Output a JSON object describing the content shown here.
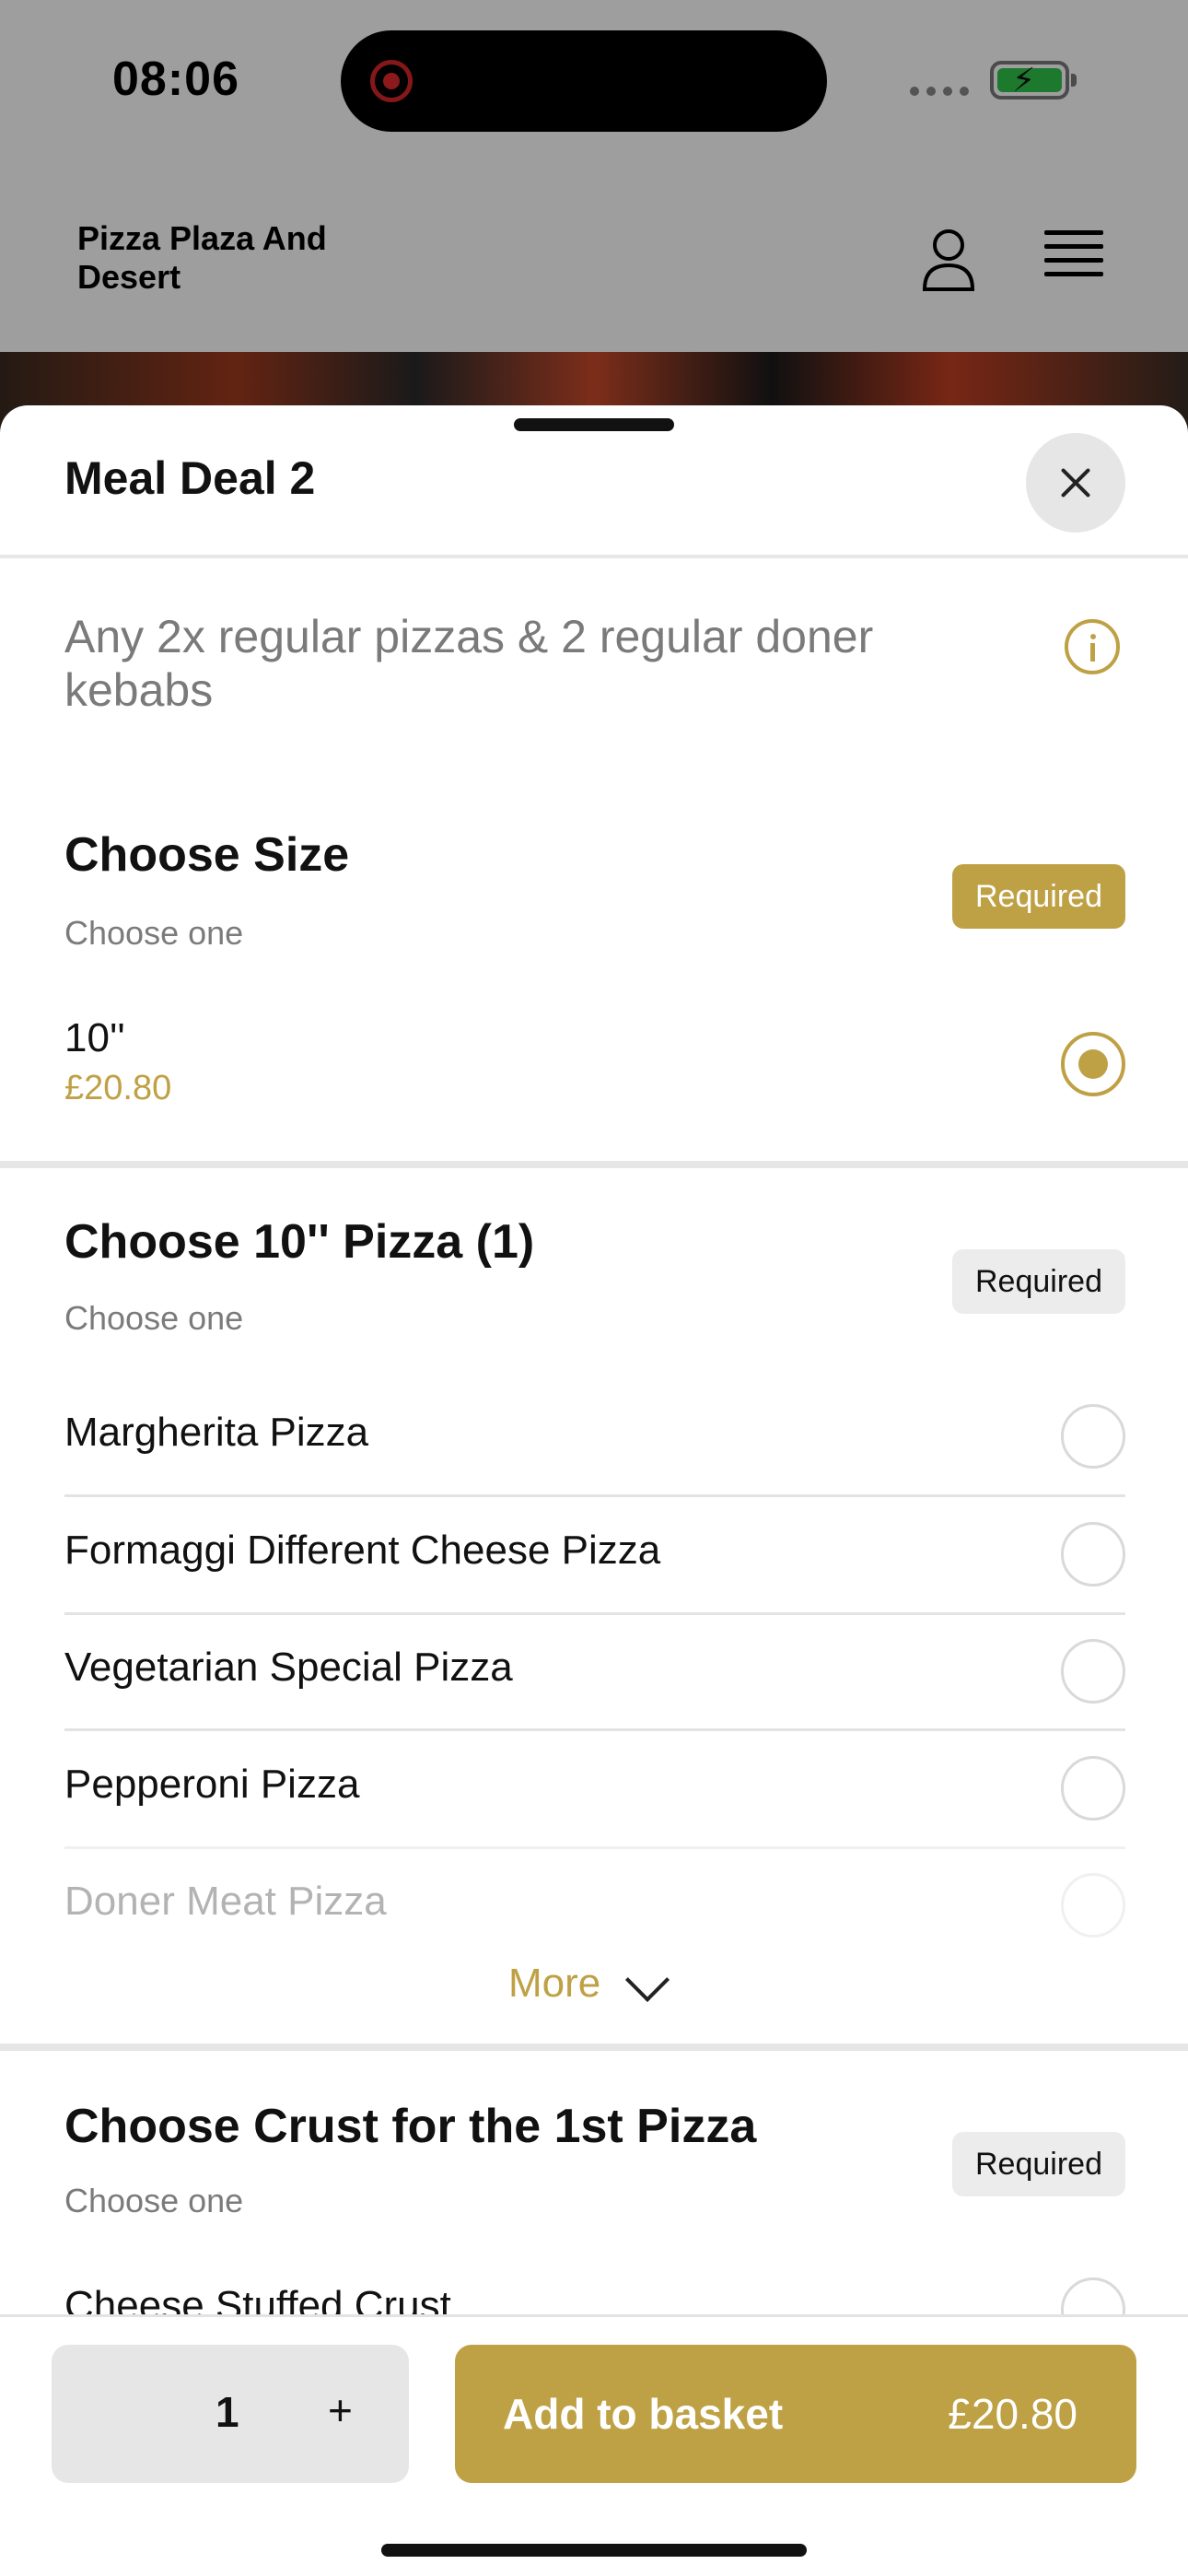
{
  "status_bar": {
    "time": "08:06"
  },
  "store": {
    "name": "Pizza Plaza And Desert"
  },
  "sheet": {
    "title": "Meal Deal 2",
    "description": "Any 2x regular pizzas & 2 regular doner kebabs"
  },
  "size_section": {
    "title": "Choose Size",
    "subtitle": "Choose one",
    "badge": "Required",
    "option": {
      "label": "10''",
      "price": "£20.80",
      "selected": true
    }
  },
  "pizza_section": {
    "title": "Choose 10'' Pizza (1)",
    "subtitle": "Choose one",
    "badge": "Required",
    "options": [
      {
        "label": "Margherita Pizza"
      },
      {
        "label": "Formaggi Different Cheese Pizza"
      },
      {
        "label": "Vegetarian Special Pizza"
      },
      {
        "label": "Pepperoni Pizza"
      },
      {
        "label": "Doner Meat Pizza"
      }
    ],
    "more_label": "More"
  },
  "crust_section": {
    "title": "Choose Crust for the 1st Pizza",
    "subtitle": "Choose one",
    "badge": "Required",
    "first_option": "Cheese Stuffed Crust"
  },
  "footer": {
    "quantity": "1",
    "plus": "+",
    "add_label": "Add to basket",
    "add_price": "£20.80"
  },
  "colors": {
    "accent": "#bfa145",
    "badge_grey": "#ececec"
  }
}
